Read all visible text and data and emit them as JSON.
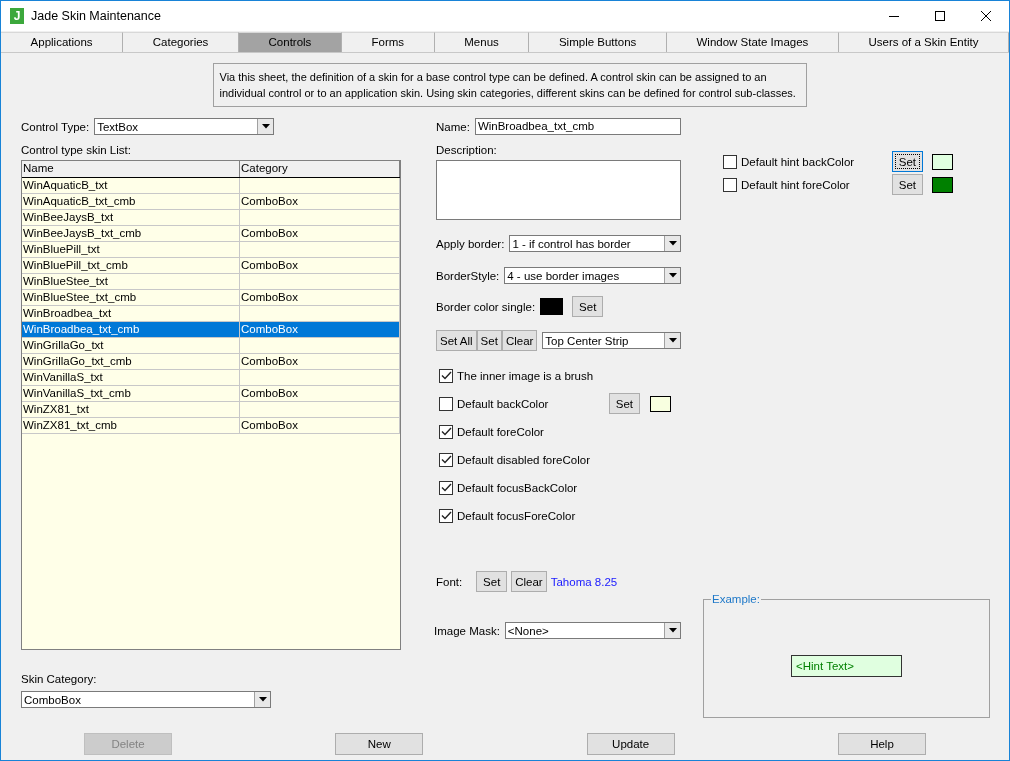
{
  "window": {
    "title": "Jade Skin Maintenance",
    "icon_letter": "J"
  },
  "tabs": [
    {
      "label": "Applications",
      "selected": false
    },
    {
      "label": "Categories",
      "selected": false
    },
    {
      "label": "Controls",
      "selected": true
    },
    {
      "label": "Forms",
      "selected": false
    },
    {
      "label": "Menus",
      "selected": false
    },
    {
      "label": "Simple Buttons",
      "selected": false
    },
    {
      "label": "Window State Images",
      "selected": false
    },
    {
      "label": "Users of a Skin Entity",
      "selected": false
    }
  ],
  "info_text": "Via this sheet, the definition of a skin for a base control type can be defined. A control skin can be assigned to an individual control or to an application skin. Using skin categories, different skins can be defined for control sub-classes.",
  "control_type": {
    "label": "Control Type:",
    "value": "TextBox"
  },
  "skin_list": {
    "label": "Control type skin List:",
    "columns": [
      "Name",
      "Category"
    ],
    "rows": [
      {
        "name": "WinAquaticB_txt",
        "selected": false
      },
      {
        "name": "WinAquaticB_txt_cmb",
        "category": "ComboBox",
        "selected": false
      },
      {
        "name": "WinBeeJaysB_txt",
        "selected": false
      },
      {
        "name": "WinBeeJaysB_txt_cmb",
        "category": "ComboBox",
        "selected": false
      },
      {
        "name": "WinBluePill_txt",
        "selected": false
      },
      {
        "name": "WinBluePill_txt_cmb",
        "category": "ComboBox",
        "selected": false
      },
      {
        "name": "WinBlueStee_txt",
        "selected": false
      },
      {
        "name": "WinBlueStee_txt_cmb",
        "category": "ComboBox",
        "selected": false
      },
      {
        "name": "WinBroadbea_txt",
        "selected": false
      },
      {
        "name": "WinBroadbea_txt_cmb",
        "category": "ComboBox",
        "selected": true
      },
      {
        "name": "WinGrillaGo_txt",
        "selected": false
      },
      {
        "name": "WinGrillaGo_txt_cmb",
        "category": "ComboBox",
        "selected": false
      },
      {
        "name": "WinVanillaS_txt",
        "selected": false
      },
      {
        "name": "WinVanillaS_txt_cmb",
        "category": "ComboBox",
        "selected": false
      },
      {
        "name": "WinZX81_txt",
        "selected": false
      },
      {
        "name": "WinZX81_txt_cmb",
        "category": "ComboBox",
        "selected": false
      }
    ]
  },
  "skin_category": {
    "label": "Skin Category:",
    "value": "ComboBox"
  },
  "name_field": {
    "label": "Name:",
    "value": "WinBroadbea_txt_cmb"
  },
  "description": {
    "label": "Description:"
  },
  "apply_border": {
    "label": "Apply border:",
    "value": "1 - if control has border"
  },
  "border_style": {
    "label": "BorderStyle:",
    "value": "4 - use border images"
  },
  "border_color": {
    "label": "Border color single:",
    "color": "#000000",
    "button": "Set"
  },
  "image_buttons": [
    "Set All",
    "Set",
    "Clear"
  ],
  "image_part": {
    "value": "Top Center Strip"
  },
  "options": [
    {
      "kind": "check",
      "label": "The inner image is a brush",
      "checked": true
    },
    {
      "kind": "color",
      "label": "Default backColor",
      "checked": false,
      "button": "Set",
      "color": "#f8ffe0"
    },
    {
      "kind": "check",
      "label": "Default foreColor",
      "checked": true
    },
    {
      "kind": "check",
      "label": "Default disabled foreColor",
      "checked": true
    },
    {
      "kind": "check",
      "label": "Default focusBackColor",
      "checked": true
    },
    {
      "kind": "check",
      "label": "Default focusForeColor",
      "checked": true
    }
  ],
  "font": {
    "label": "Font:",
    "buttons": [
      "Set",
      "Clear"
    ],
    "value": "Tahoma 8.25"
  },
  "image_mask": {
    "label": "Image Mask:",
    "value": "<None>"
  },
  "hint_options": [
    {
      "label": "Default hint backColor",
      "checked": false,
      "button": "Set",
      "focused": true,
      "color": "#e0ffe0"
    },
    {
      "label": "Default hint foreColor",
      "checked": false,
      "button": "Set",
      "focused": false,
      "color": "#008000"
    }
  ],
  "example": {
    "label": "Example:",
    "hint_text": "<Hint Text>"
  },
  "buttons": [
    {
      "label": "Delete",
      "disabled": true
    },
    {
      "label": "New",
      "disabled": false
    },
    {
      "label": "Update",
      "disabled": false
    },
    {
      "label": "Help",
      "disabled": false
    }
  ]
}
